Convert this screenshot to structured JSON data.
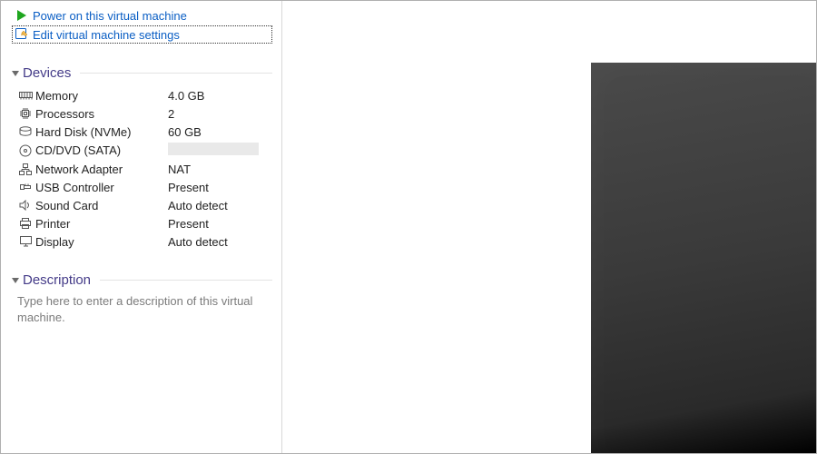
{
  "actions": {
    "power_on": "Power on this virtual machine",
    "edit_settings": "Edit virtual machine settings"
  },
  "sections": {
    "devices_title": "Devices",
    "description_title": "Description"
  },
  "devices": {
    "memory_label": "Memory",
    "memory_value": "4.0 GB",
    "processors_label": "Processors",
    "processors_value": "2",
    "harddisk_label": "Hard Disk (NVMe)",
    "harddisk_value": "60 GB",
    "cddvd_label": "CD/DVD (SATA)",
    "network_label": "Network Adapter",
    "network_value": "NAT",
    "usb_label": "USB Controller",
    "usb_value": "Present",
    "sound_label": "Sound Card",
    "sound_value": "Auto detect",
    "printer_label": "Printer",
    "printer_value": "Present",
    "display_label": "Display",
    "display_value": "Auto detect"
  },
  "description": {
    "placeholder": "Type here to enter a description of this virtual machine."
  }
}
